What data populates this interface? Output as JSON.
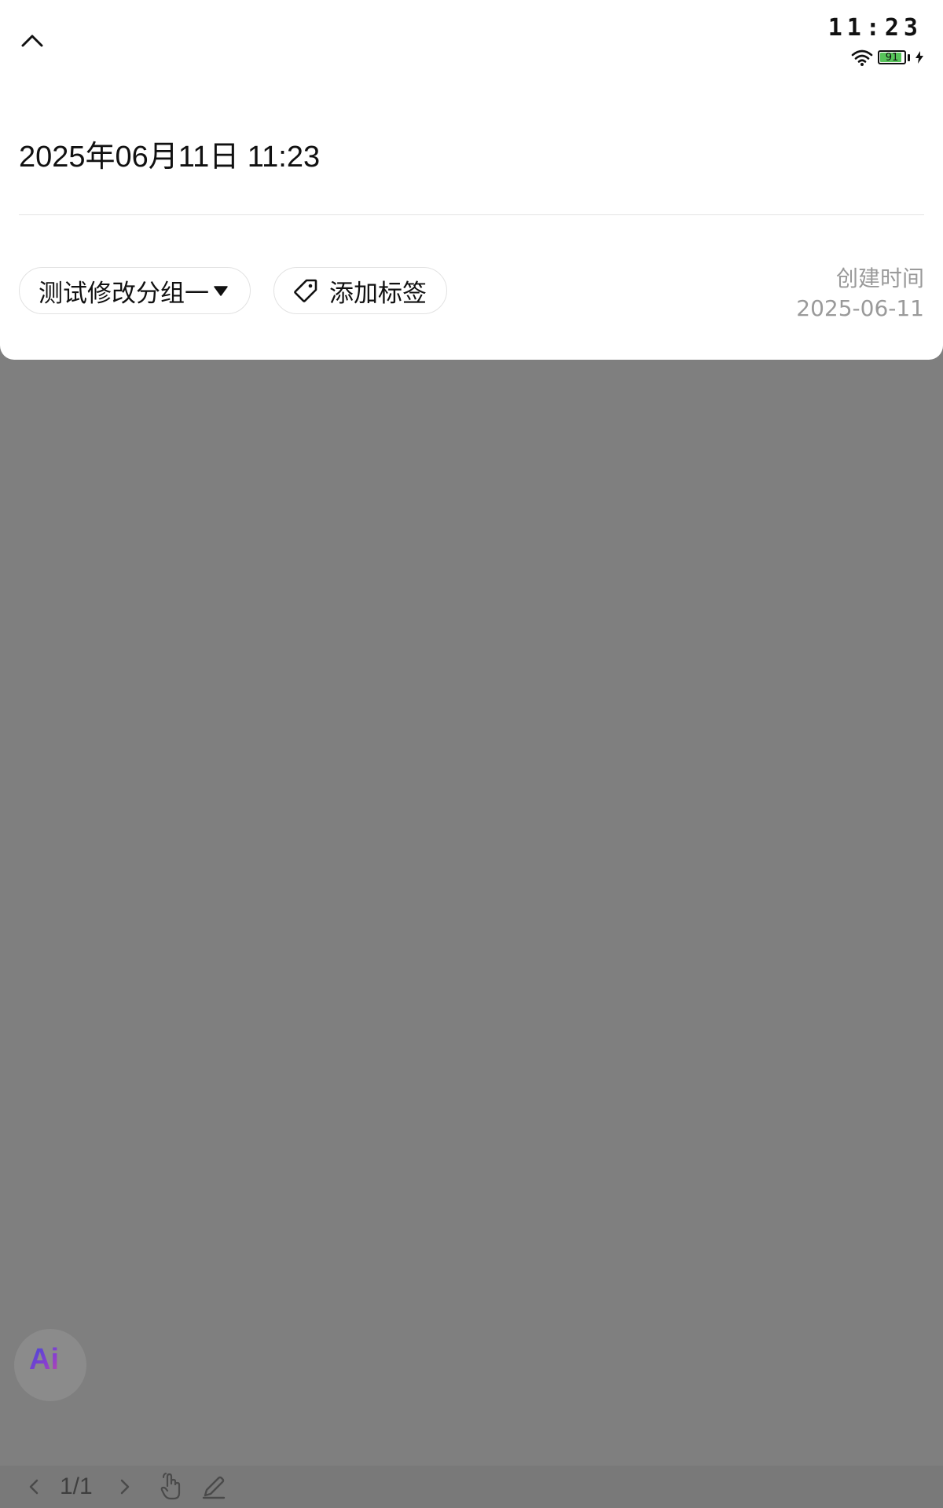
{
  "status_bar": {
    "time": "11:23",
    "battery_level": "91",
    "battery_fraction": 0.91,
    "charging": true,
    "icons": [
      "wifi-icon",
      "battery-icon",
      "charging-bolt-icon"
    ]
  },
  "header": {
    "collapse_icon": "chevron-up-icon"
  },
  "note": {
    "title": "2025年06月11日 11:23"
  },
  "meta": {
    "group_label": "测试修改分组一",
    "group_caret_icon": "caret-down-icon",
    "tag_icon": "tag-icon",
    "tag_label": "添加标签",
    "created_label": "创建时间",
    "created_date": "2025-06-11"
  },
  "ai_button": {
    "label": "Ai"
  },
  "toolbar": {
    "prev_icon": "chevron-left-icon",
    "page_indicator": "1/1",
    "next_icon": "chevron-right-icon",
    "hand_icon": "hand-pointer-icon",
    "pen_icon": "pen-icon"
  },
  "colors": {
    "overlay": "#7f7f7f",
    "sheet": "#ffffff",
    "muted_text": "#9a9a9a",
    "battery_fill": "#57c45a",
    "ai_gradient_start": "#3a4bd6",
    "ai_gradient_end": "#c34a9f"
  }
}
